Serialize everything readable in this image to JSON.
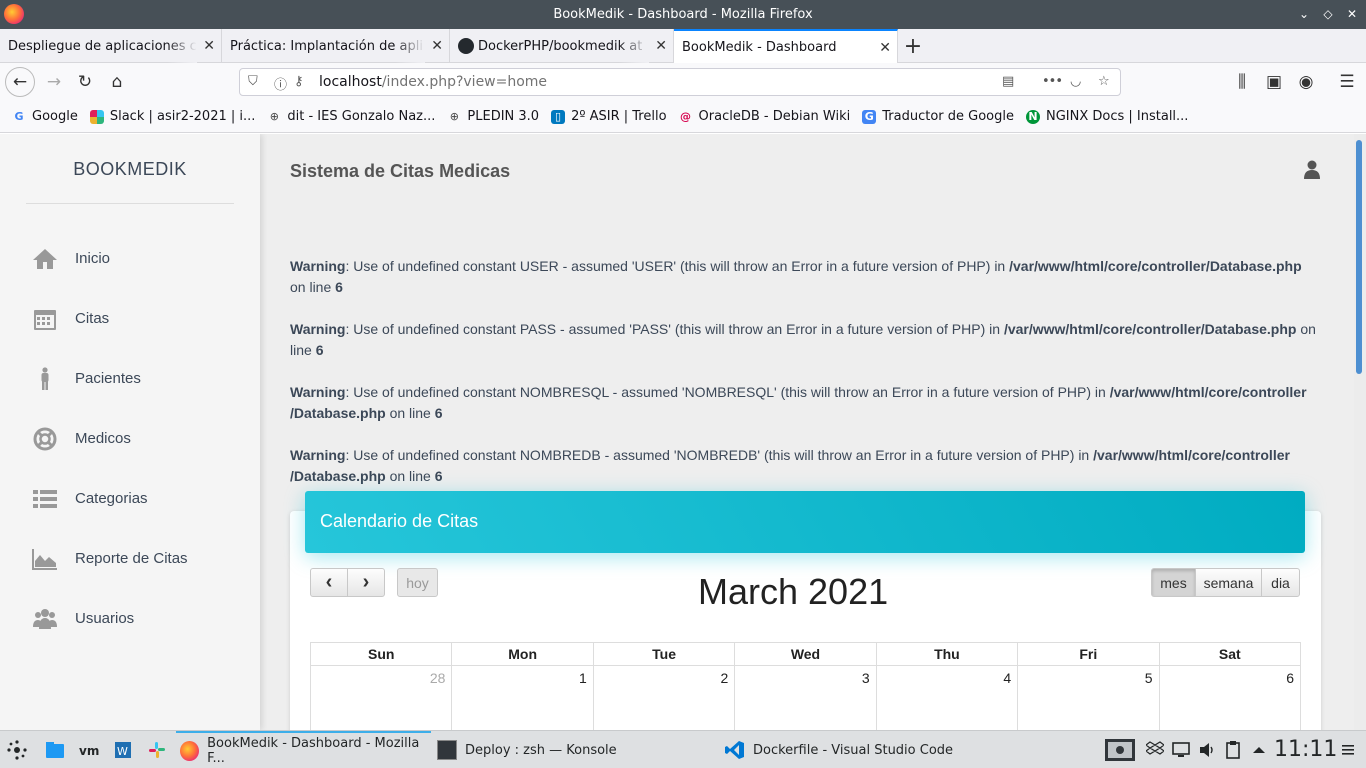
{
  "window": {
    "title": "BookMedik - Dashboard - Mozilla Firefox"
  },
  "tabs": [
    {
      "label": "Despliegue de aplicaciones co",
      "active": false
    },
    {
      "label": "Práctica: Implantación de apli",
      "active": false
    },
    {
      "label": "DockerPHP/bookmedik at",
      "active": false
    },
    {
      "label": "BookMedik - Dashboard",
      "active": true
    }
  ],
  "address": {
    "host": "localhost",
    "path": "/index.php?view=home"
  },
  "bookmarks": [
    {
      "label": "Google",
      "icon": "google-icon"
    },
    {
      "label": "Slack | asir2-2021 | i...",
      "icon": "slack-icon"
    },
    {
      "label": "dit - IES Gonzalo Naz...",
      "icon": "globe-icon"
    },
    {
      "label": "PLEDIN 3.0",
      "icon": "globe-icon"
    },
    {
      "label": "2º ASIR | Trello",
      "icon": "trello-icon"
    },
    {
      "label": "OracleDB - Debian Wiki",
      "icon": "debian-icon"
    },
    {
      "label": "Traductor de Google",
      "icon": "translate-icon"
    },
    {
      "label": "NGINX Docs | Install...",
      "icon": "nginx-icon"
    }
  ],
  "sidebar": {
    "brand": "BOOKMEDIK",
    "items": [
      {
        "label": "Inicio",
        "icon": "home-icon"
      },
      {
        "label": "Citas",
        "icon": "calendar-icon"
      },
      {
        "label": "Pacientes",
        "icon": "person-icon"
      },
      {
        "label": "Medicos",
        "icon": "lifesaver-icon"
      },
      {
        "label": "Categorias",
        "icon": "list-icon"
      },
      {
        "label": "Reporte de Citas",
        "icon": "area-chart-icon"
      },
      {
        "label": "Usuarios",
        "icon": "users-icon"
      }
    ]
  },
  "main": {
    "title": "Sistema de Citas Medicas",
    "warnings": [
      {
        "label": "Warning",
        "text1": ": Use of undefined constant USER - assumed 'USER' (this will throw an Error in a future version of PHP) in ",
        "file": "/var/www/html/core/controller/Database.php",
        "text2": " on line ",
        "line": "6"
      },
      {
        "label": "Warning",
        "text1": ": Use of undefined constant PASS - assumed 'PASS' (this will throw an Error in a future version of PHP) in ",
        "file": "/var/www/html/core/controller/Database.php",
        "text2": " on line ",
        "line": "6"
      },
      {
        "label": "Warning",
        "text1": ": Use of undefined constant NOMBRESQL - assumed 'NOMBRESQL' (this will throw an Error in a future version of PHP) in ",
        "file": "/var/www/html/core/controller /Database.php",
        "text2": " on line ",
        "line": "6"
      },
      {
        "label": "Warning",
        "text1": ": Use of undefined constant NOMBREDB - assumed 'NOMBREDB' (this will throw an Error in a future version of PHP) in ",
        "file": "/var/www/html/core/controller /Database.php",
        "text2": " on line ",
        "line": "6"
      }
    ]
  },
  "calendar": {
    "header": "Calendario de Citas",
    "prev": "‹",
    "next": "›",
    "today": "hoy",
    "title": "March 2021",
    "views": {
      "month": "mes",
      "week": "semana",
      "day": "dia"
    },
    "days": [
      "Sun",
      "Mon",
      "Tue",
      "Wed",
      "Thu",
      "Fri",
      "Sat"
    ],
    "week1": [
      "28",
      "1",
      "2",
      "3",
      "4",
      "5",
      "6"
    ]
  },
  "taskbar": {
    "tasks": [
      "BookMedik - Dashboard - Mozilla F...",
      "Deploy : zsh — Konsole",
      "Dockerfile - Visual Studio Code"
    ],
    "clock": "11:11"
  },
  "colors": {
    "accent": "#0a84ff",
    "card_header": "#00bcd4",
    "sidebar_bg": "#f5f5f5",
    "content_bg": "#eeeeee"
  }
}
